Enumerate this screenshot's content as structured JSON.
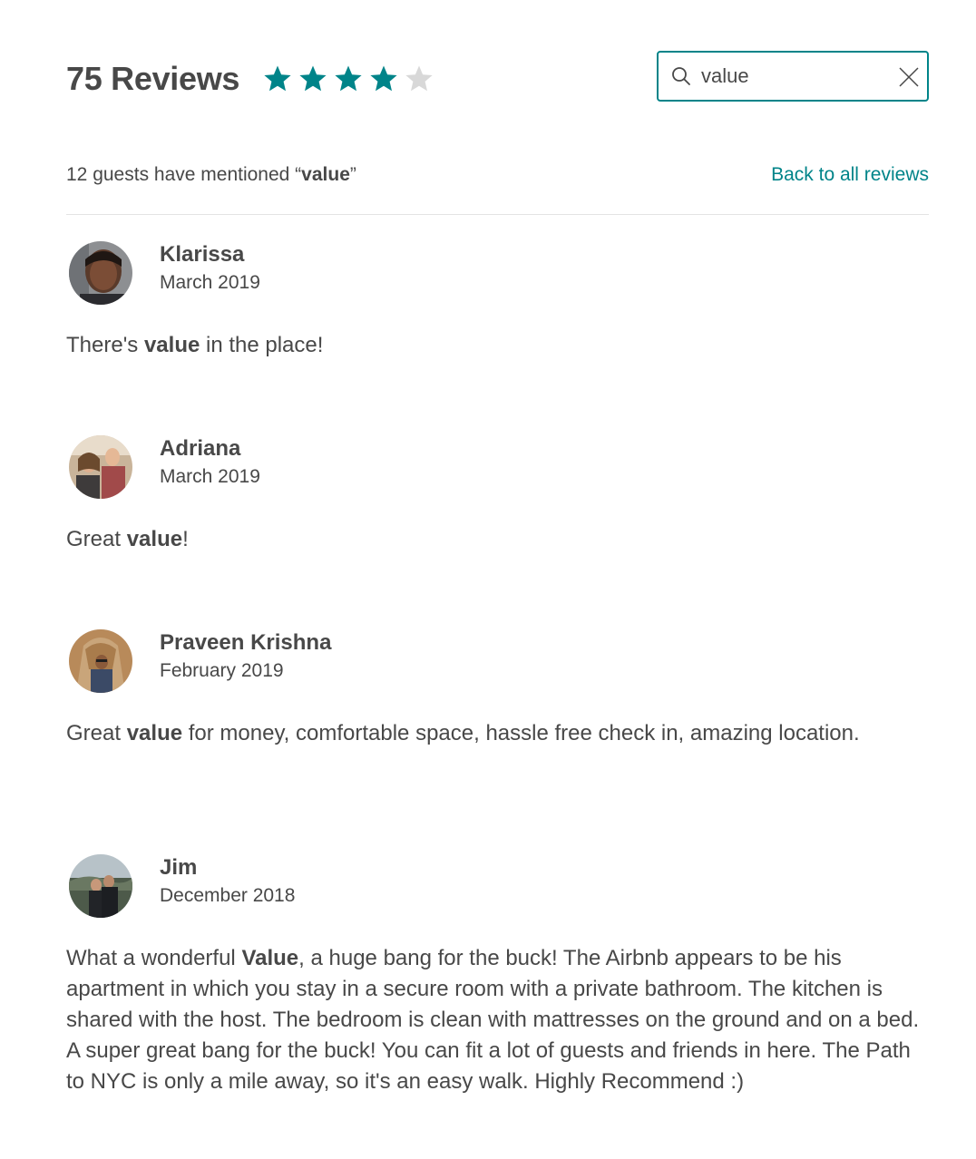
{
  "header": {
    "title": "75 Reviews",
    "rating": 4,
    "max_rating": 5,
    "star_color": "#008489",
    "empty_star_color": "#d8d8d8"
  },
  "search": {
    "value": "value",
    "icon": "search-icon",
    "clear_icon": "close-icon",
    "border_color": "#008489"
  },
  "summary": {
    "prefix": "12 guests have mentioned “",
    "keyword": "value",
    "suffix": "”"
  },
  "back_link": "Back to all reviews",
  "accent_color": "#008489",
  "reviews": [
    {
      "name": "Klarissa",
      "date": "March 2019",
      "text": [
        {
          "t": "There's ",
          "b": false
        },
        {
          "t": "value",
          "b": true
        },
        {
          "t": " in the place!",
          "b": false
        }
      ]
    },
    {
      "name": "Adriana",
      "date": "March 2019",
      "text": [
        {
          "t": "Great ",
          "b": false
        },
        {
          "t": "value",
          "b": true
        },
        {
          "t": "!",
          "b": false
        }
      ]
    },
    {
      "name": "Praveen Krishna",
      "date": "February 2019",
      "text": [
        {
          "t": "Great ",
          "b": false
        },
        {
          "t": "value",
          "b": true
        },
        {
          "t": " for money, comfortable space, hassle free check in, amazing location.",
          "b": false
        }
      ]
    },
    {
      "name": "Jim",
      "date": "December 2018",
      "text": [
        {
          "t": "What a wonderful ",
          "b": false
        },
        {
          "t": "Value",
          "b": true
        },
        {
          "t": ", a huge bang for the buck! The Airbnb appears to be his apartment in which you stay in a secure room with a private bathroom. The kitchen is shared with the host. The bedroom is clean with mattresses on the ground and on a bed. A super great bang for the buck! You can fit a lot of guests and friends in here. The Path to NYC is only a mile away, so it's an easy walk. Highly Recommend :)",
          "b": false
        }
      ]
    }
  ]
}
